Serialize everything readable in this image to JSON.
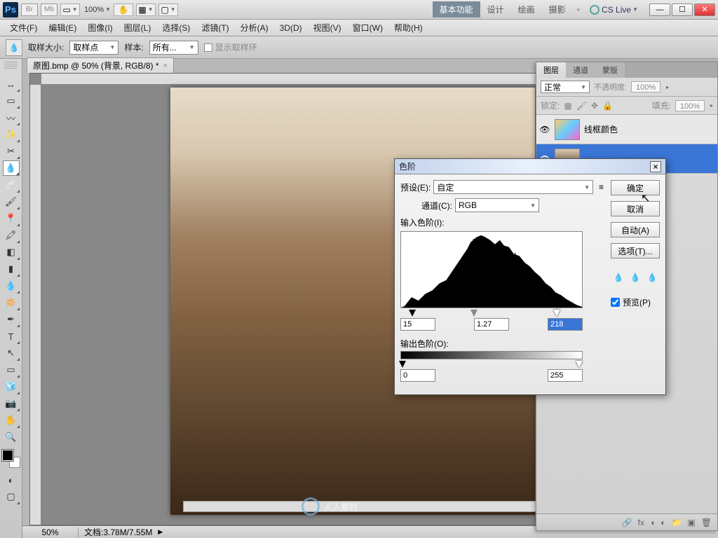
{
  "titlebar": {
    "zoom": "100%",
    "tabs": [
      "基本功能",
      "设计",
      "绘画",
      "摄影"
    ],
    "active_tab": "基本功能",
    "cslive": "CS Live"
  },
  "menus": [
    "文件(F)",
    "编辑(E)",
    "图像(I)",
    "图层(L)",
    "选择(S)",
    "滤镜(T)",
    "分析(A)",
    "3D(D)",
    "视图(V)",
    "窗口(W)",
    "帮助(H)"
  ],
  "options": {
    "sample_size_label": "取样大小:",
    "sample_size_value": "取样点",
    "sample_label": "样本:",
    "sample_value": "所有...",
    "ring_label": "显示取样环"
  },
  "doctab": "原图.bmp @ 50% (背景, RGB/8) *",
  "statusbar": {
    "pct": "50%",
    "info": "文档:3.78M/7.55M"
  },
  "layers_panel": {
    "tabs": [
      "图层",
      "通道",
      "蒙版"
    ],
    "blend": "正常",
    "opacity_label": "不透明度:",
    "opacity": "100%",
    "lock_label": "锁定:",
    "fill_label": "填充:",
    "fill": "100%",
    "layer1": "线框颜色"
  },
  "levels": {
    "title": "色阶",
    "preset_label": "预设(E):",
    "preset_value": "自定",
    "channel_label": "通道(C):",
    "channel_value": "RGB",
    "input_label": "输入色阶(I):",
    "shadows": "15",
    "mid": "1.27",
    "highlights": "218",
    "output_label": "输出色阶(O):",
    "out_low": "0",
    "out_high": "255",
    "ok": "确定",
    "cancel": "取消",
    "auto": "自动(A)",
    "options": "选项(T)...",
    "preview": "预览(P)"
  },
  "watermark": "人人素材"
}
